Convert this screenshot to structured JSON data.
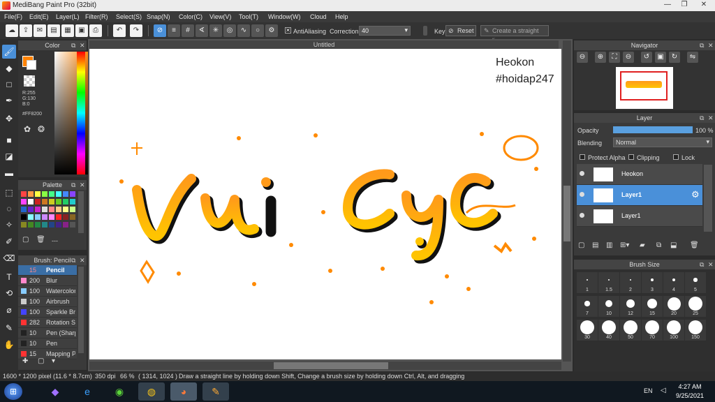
{
  "app": {
    "title": "MediBang Paint Pro (32bit)"
  },
  "menu": [
    "File(F)",
    "Edit(E)",
    "Layer(L)",
    "Filter(R)",
    "Select(S)",
    "Snap(N)",
    "Color(C)",
    "View(V)",
    "Tool(T)",
    "Window(W)",
    "Cloud",
    "Help"
  ],
  "toolbar": {
    "antialiasing_label": "AntiAliasing",
    "correction_label": "Correction",
    "correction_value": "40",
    "key_label": "Key",
    "reset_label": "Reset",
    "straight_line_label": "Create a straight line"
  },
  "color_panel": {
    "title": "Color",
    "r": "R:255",
    "g": "G:130",
    "b": "B:0",
    "hex": "#FF8200",
    "primary": "#FF8200"
  },
  "palette_panel": {
    "title": "Palette",
    "footer": "---",
    "colors": [
      "#ff4444",
      "#ff9944",
      "#ffff44",
      "#88ff44",
      "#44ff88",
      "#44ffff",
      "#4488ff",
      "#8844ff",
      "#ff44ff",
      "#ffffff",
      "#cc2222",
      "#cc7722",
      "#cccc22",
      "#66cc22",
      "#22cc66",
      "#22cccc",
      "#2266cc",
      "#6622cc",
      "#cc22cc",
      "#dddddd",
      "#ff8888",
      "#ffcc88",
      "#ffff88",
      "#ccff88",
      "#000000",
      "#88ffff",
      "#88ccff",
      "#cc88ff",
      "#ff88ff",
      "#ff2222",
      "#882222",
      "#886622",
      "#888822",
      "#448822",
      "#228844",
      "#228888",
      "#224488",
      "#442288",
      "#882288",
      "#555555"
    ]
  },
  "brush_panel": {
    "title": "Brush: Pencil",
    "items": [
      {
        "size": "15",
        "name": "Pencil",
        "color": "#3a6ea5"
      },
      {
        "size": "200",
        "name": "Blur",
        "color": "#ff88cc"
      },
      {
        "size": "100",
        "name": "Watercolor",
        "color": "#88ccff"
      },
      {
        "size": "100",
        "name": "Airbrush",
        "color": "#cccccc"
      },
      {
        "size": "100",
        "name": "Sparkle Brush",
        "color": "#4444ff"
      },
      {
        "size": "282",
        "name": "Rotation Symmetry",
        "color": "#ff3333"
      },
      {
        "size": "10",
        "name": "Pen (Sharp)",
        "color": "#222222"
      },
      {
        "size": "10",
        "name": "Pen",
        "color": "#222222"
      },
      {
        "size": "15",
        "name": "Mapping Pen",
        "color": "#ff3333"
      }
    ]
  },
  "canvas": {
    "tab": "Untitled",
    "signature_line1": "Heokon",
    "signature_line2": "#hoidap247",
    "art_text": "Vui cực"
  },
  "navigator": {
    "title": "Navigator"
  },
  "layer_panel": {
    "title": "Layer",
    "opacity_label": "Opacity",
    "opacity_value": "100 %",
    "opacity_fraction": 1.0,
    "blending_label": "Blending",
    "blending_value": "Normal",
    "protect_alpha": "Protect Alpha",
    "clipping": "Clipping",
    "lock": "Lock",
    "layers": [
      {
        "name": "Heokon",
        "selected": false
      },
      {
        "name": "Layer1",
        "selected": true
      },
      {
        "name": "Layer1",
        "selected": false
      }
    ]
  },
  "brush_size_panel": {
    "title": "Brush Size",
    "sizes": [
      "1",
      "1.5",
      "2",
      "3",
      "4",
      "5",
      "7",
      "10",
      "12",
      "15",
      "20",
      "25",
      "30",
      "40",
      "50",
      "70",
      "100",
      "150"
    ]
  },
  "status": {
    "pixel": "1600 * 1200 pixel",
    "size": "(11.6 * 8.7cm)",
    "dpi": "350 dpi",
    "zoom": "66 %",
    "coords": "( 1314, 1024 )",
    "hint": "Draw a straight line by holding down Shift, Change a brush size by holding down Ctrl, Alt, and dragging"
  },
  "taskbar": {
    "lang": "EN",
    "time": "4:27 AM",
    "date": "9/25/2021"
  }
}
